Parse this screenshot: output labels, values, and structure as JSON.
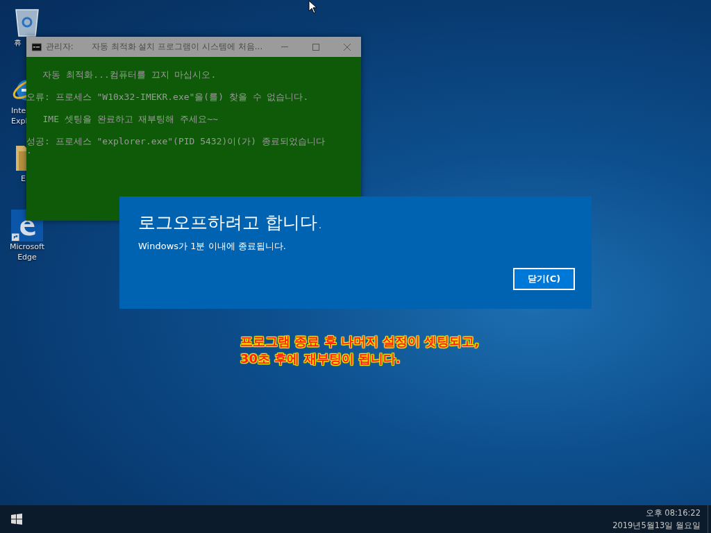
{
  "desktop_icons": [
    {
      "kind": "recycle",
      "label": "휴"
    },
    {
      "kind": "ie",
      "label": "Inte Expl"
    },
    {
      "kind": "folder",
      "label": "E"
    },
    {
      "kind": "edge",
      "label": "Microsoft Edge"
    }
  ],
  "console_window": {
    "title_prefix": "관리자:",
    "title": "자동  최적화 설치 프로그램이 시스템에 처음...",
    "lines": [
      "   자동 최적화...컴퓨터를 끄지 마십시오.",
      "오류: 프로세스 \"W10x32-IMEKR.exe\"을(를) 찾을 수 없습니다.",
      "   IME 셋팅을 완료하고 재부팅해 주세요~~",
      "성공: 프로세스 \"explorer.exe\"(PID 5432)이(가) 종료되었습니다",
      "."
    ]
  },
  "dialog": {
    "title": "로그오프하려고 합니다.",
    "message": "Windows가 1분 이내에 종료됩니다.",
    "button": "닫기(C)"
  },
  "annotation": {
    "lines": [
      "프로그램 종료 후 나머지 설정이 셋팅되고,",
      "30초 후에 재부팅이 됩니다."
    ]
  },
  "taskbar": {
    "time": "오후 08:16:22",
    "date": "2019년5월13일 월요일"
  }
}
